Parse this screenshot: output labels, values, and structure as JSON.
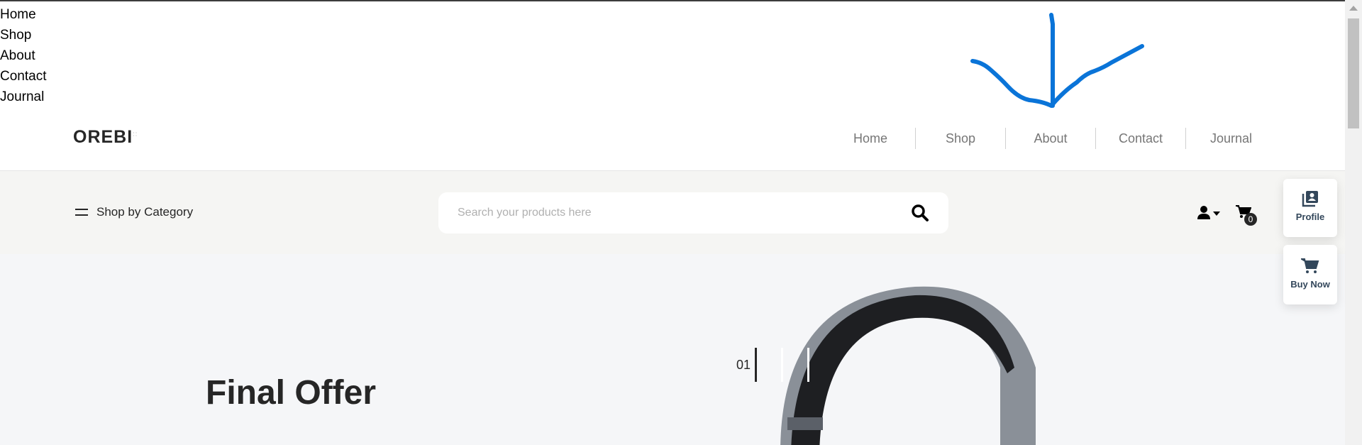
{
  "raw_links": [
    "Home",
    "Shop",
    "About",
    "Contact",
    "Journal"
  ],
  "logo": "OREBI",
  "nav": [
    "Home",
    "Shop",
    "About",
    "Contact",
    "Journal"
  ],
  "category_label": "Shop by Category",
  "search": {
    "placeholder": "Search your products here"
  },
  "cart_count": "0",
  "side_buttons": {
    "profile": "Profile",
    "buy_now": "Buy Now"
  },
  "hero": {
    "title": "Final Offer",
    "slide_number": "01"
  },
  "colors": {
    "annotation": "#0a74d8",
    "bar": "#f5f5f3",
    "hero": "#f5f6f8"
  }
}
